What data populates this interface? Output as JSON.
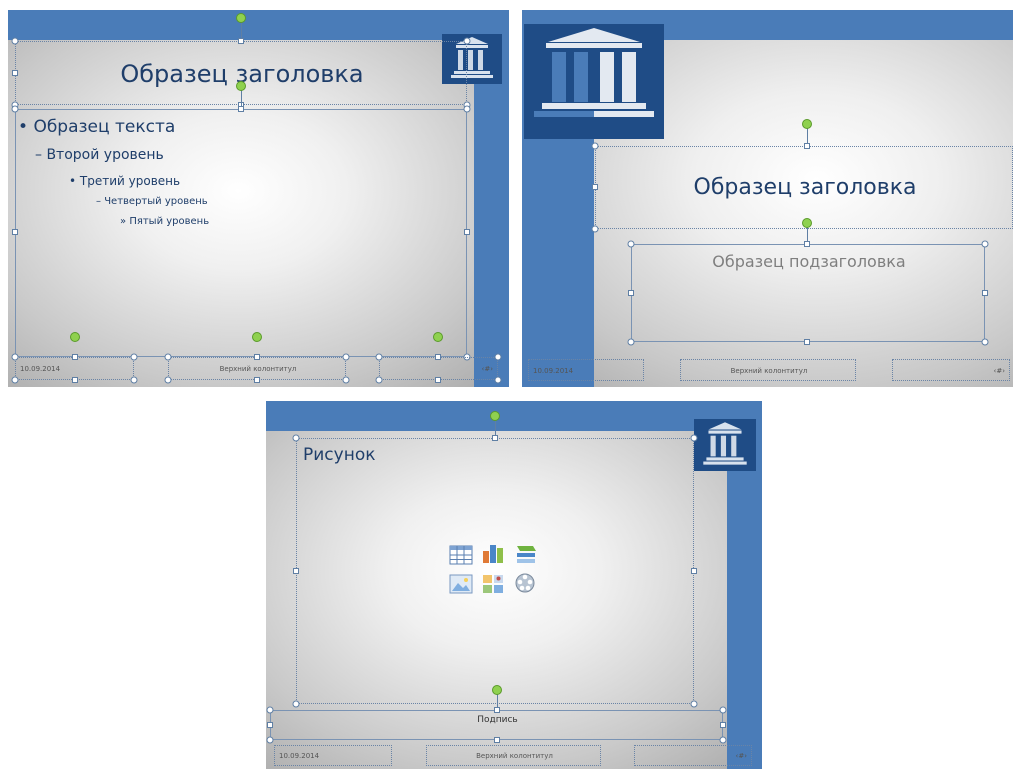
{
  "colors": {
    "blue_bar": "#4a7cb8",
    "logo_blue": "#1f4c86",
    "title_text": "#1f3e6a",
    "handle_green": "#8fd14f"
  },
  "slide1": {
    "title": "Образец заголовка",
    "bullets": [
      "Образец текста",
      "Второй уровень",
      "Третий уровень",
      "Четвертый уровень",
      "Пятый уровень"
    ],
    "markers": [
      "•",
      "–",
      "•",
      "–",
      "»"
    ],
    "footer_date": "10.09.2014",
    "footer_center": "Верхний колонтитул",
    "footer_num": "‹#›"
  },
  "slide2": {
    "title": "Образец заголовка",
    "subtitle": "Образец подзаголовка",
    "footer_date": "10.09.2014",
    "footer_center": "Верхний колонтитул",
    "footer_num": "‹#›"
  },
  "slide3": {
    "picture_label": "Рисунок",
    "caption": "Подпись",
    "footer_date": "10.09.2014",
    "footer_center": "Верхний колонтитул",
    "footer_num": "‹#›",
    "content_icons": [
      "table-icon",
      "chart-icon",
      "smartart-icon",
      "picture-icon",
      "clipart-icon",
      "media-icon"
    ]
  }
}
